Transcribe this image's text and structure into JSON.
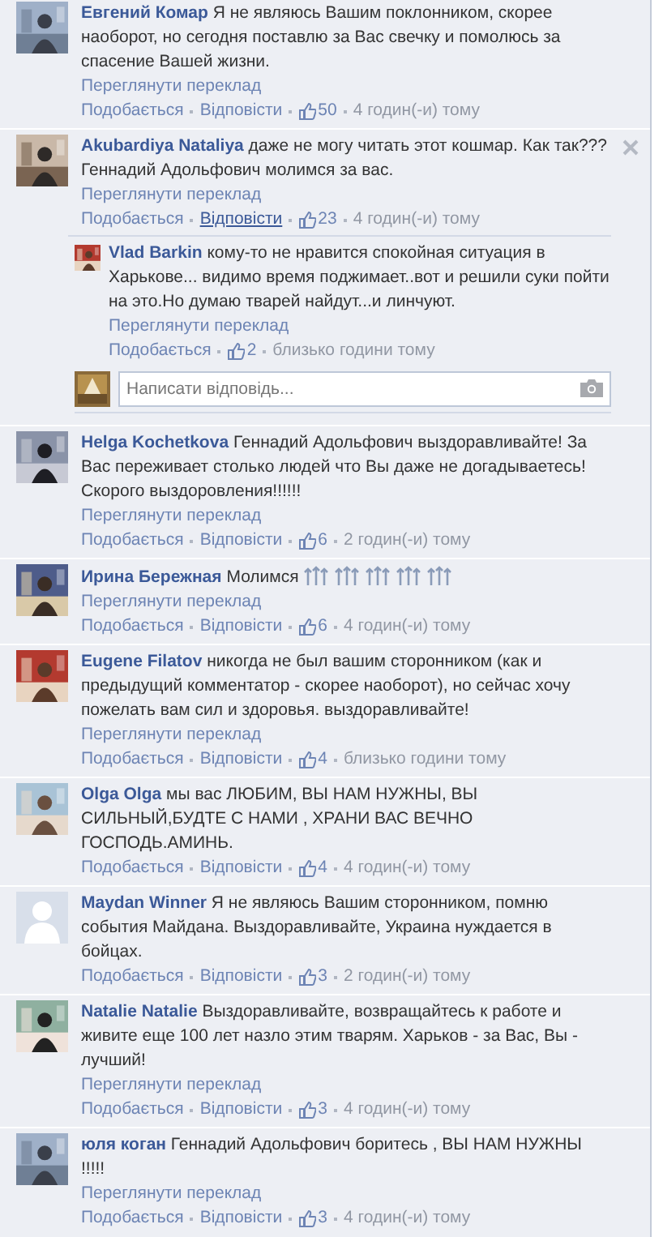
{
  "comments": [
    {
      "author": "Евгений Комар",
      "text": "Я не являюсь Вашим поклонником, скорее наоборот, но сегодня поставлю за Вас свечку и помолюсь за спасение Вашей жизни.",
      "translate": "Переглянути переклад",
      "like": "Подобається",
      "reply": "Відповісти",
      "reply_hovered": false,
      "likes": "50",
      "time": "4 годин(-и) тому",
      "close_visible": false
    },
    {
      "author": "Akubardiya Nataliya",
      "text": "даже не могу читать этот кошмар. Как так??? Геннадий Адольфович молимся за вас.",
      "translate": "Переглянути переклад",
      "like": "Подобається",
      "reply": "Відповісти",
      "reply_hovered": true,
      "likes": "23",
      "time": "4 годин(-и) тому",
      "close_visible": true,
      "replies": [
        {
          "author": "Vlad Barkin",
          "text": "кому-то не нравится спокойная ситуация в Харькове... видимо время поджимает..вот и решили суки пойти на это.Но думаю тварей найдут...и линчуют.",
          "translate": "Переглянути переклад",
          "like": "Подобається",
          "likes": "2",
          "time": "близько години тому"
        }
      ],
      "reply_field": {
        "placeholder": "Написати відповідь..."
      }
    },
    {
      "author": "Helga Kochetkova",
      "text": "Геннадий Адольфович выздоравливайте! За Вас переживает столько людей что Вы даже не догадываетесь!Скорого выздоровления!!!!!!",
      "translate": "Переглянути переклад",
      "like": "Подобається",
      "reply": "Відповісти",
      "reply_hovered": false,
      "likes": "6",
      "time": "2 годин(-и) тому",
      "close_visible": false
    },
    {
      "author": "Ирина Бережная",
      "text": "Молимся",
      "emoticons": [
        {
          "kind": "candles"
        },
        {
          "kind": "candles"
        },
        {
          "kind": "candles"
        },
        {
          "kind": "candles"
        },
        {
          "kind": "candles"
        }
      ],
      "translate": "Переглянути переклад",
      "like": "Подобається",
      "reply": "Відповісти",
      "reply_hovered": false,
      "likes": "6",
      "time": "4 годин(-и) тому",
      "close_visible": false
    },
    {
      "author": "Eugene Filatov",
      "text": "никогда не был вашим сторонником (как и предыдущий комментатор - скорее наоборот), но сейчас хочу пожелать вам сил и здоровья. выздоравливайте!",
      "translate": "Переглянути переклад",
      "like": "Подобається",
      "reply": "Відповісти",
      "reply_hovered": false,
      "likes": "4",
      "time": "близько години тому",
      "close_visible": false
    },
    {
      "author": "Olga Olga",
      "text": "мы вас ЛЮБИМ, ВЫ НАМ НУЖНЫ, ВЫ СИЛЬНЫЙ,БУДТЕ С НАМИ , ХРАНИ ВАС ВЕЧНО ГОСПОДЬ.АМИНЬ.",
      "like": "Подобається",
      "reply": "Відповісти",
      "reply_hovered": false,
      "likes": "4",
      "time": "4 годин(-и) тому",
      "close_visible": false
    },
    {
      "author": "Maydan Winner",
      "text": "Я не являюсь Вашим сторонником, помню события Майдана. Выздоравливайте, Украина нуждается в бойцах.",
      "like": "Подобається",
      "reply": "Відповісти",
      "reply_hovered": false,
      "likes": "3",
      "time": "2 годин(-и) тому",
      "close_visible": false,
      "kind": "default"
    },
    {
      "author": "Natalie Natalie",
      "text": "Выздоравливайте, возвращайтесь к работе и живите еще 100 лет назло этим тварям. Харьков - за Вас, Вы - лучший!",
      "translate": "Переглянути переклад",
      "like": "Подобається",
      "reply": "Відповісти",
      "reply_hovered": false,
      "likes": "3",
      "time": "4 годин(-и) тому",
      "close_visible": false
    },
    {
      "author": "юля коган",
      "text": "Геннадий Адольфович боритесь , ВЫ НАМ НУЖНЫ !!!!!",
      "translate": "Переглянути переклад",
      "like": "Подобається",
      "reply": "Відповісти",
      "reply_hovered": false,
      "likes": "3",
      "time": "4 годин(-и) тому",
      "close_visible": false
    }
  ]
}
